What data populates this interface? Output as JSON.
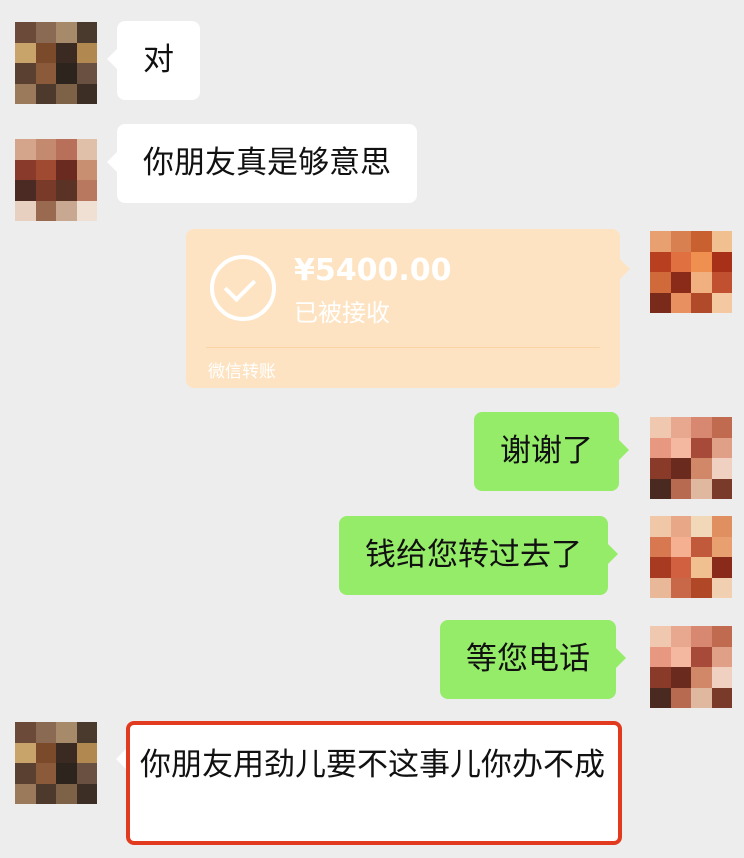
{
  "messages": [
    {
      "text": "对",
      "direction": "incoming"
    },
    {
      "text": "你朋友真是够意思",
      "direction": "incoming"
    },
    {
      "type": "transfer",
      "direction": "outgoing",
      "amount": "¥5400.00",
      "status": "已被接收",
      "footer": "微信转账"
    },
    {
      "text": "谢谢了",
      "direction": "outgoing"
    },
    {
      "text": "钱给您转过去了",
      "direction": "outgoing"
    },
    {
      "text": "等您电话",
      "direction": "outgoing"
    },
    {
      "text": "你朋友用劲儿要不这事儿你办不成",
      "direction": "incoming",
      "highlighted": true
    }
  ],
  "colors": {
    "background": "#ededed",
    "incoming_bubble": "#ffffff",
    "outgoing_bubble": "#95ec69",
    "transfer_card": "#fde3c1",
    "highlight_border": "#e23a1f"
  },
  "avatars": {
    "friend": [
      "#6b4a3a",
      "#8a6a52",
      "#a78a6a",
      "#4a3a2e",
      "#c8a46a",
      "#7a4a2a",
      "#3a2a22",
      "#b08850",
      "#5a4030",
      "#8a5a3a",
      "#2e241e",
      "#6a5040",
      "#9a7a5a",
      "#4e3a2c",
      "#7e6248",
      "#3c2e24"
    ],
    "friend2": [
      "#d4a58a",
      "#c48a70",
      "#b8705a",
      "#e0c0a8",
      "#8a3a2a",
      "#a04a32",
      "#6a2a20",
      "#c89070",
      "#4a2a22",
      "#7a3a2a",
      "#5a3226",
      "#b87860",
      "#e8d0c0",
      "#9a6a50",
      "#c8a890",
      "#f0e0d4"
    ],
    "self": [
      "#e8a070",
      "#d88050",
      "#c86030",
      "#f0c090",
      "#b84020",
      "#e07040",
      "#f09050",
      "#a83018",
      "#d06a3a",
      "#8a2a18",
      "#f0b080",
      "#c05030",
      "#7a2a1a",
      "#e89060",
      "#b04a28",
      "#f4c8a0"
    ],
    "self2": [
      "#f0c8b0",
      "#e8a890",
      "#d88870",
      "#c06a50",
      "#e89880",
      "#f4b8a0",
      "#a84a3a",
      "#e0a088",
      "#8a3a28",
      "#6a2a1e",
      "#d08868",
      "#f0d0c0",
      "#4a2a20",
      "#b86a50",
      "#e0b8a0",
      "#7a3a2a"
    ],
    "self3": [
      "#f0c8a8",
      "#e8a888",
      "#f0d8b8",
      "#e09060",
      "#d87850",
      "#f4b090",
      "#c05a3a",
      "#e8a070",
      "#a83a22",
      "#d06040",
      "#f0c090",
      "#8a2a1a",
      "#e8b898",
      "#c86848",
      "#b04828",
      "#f0d0b0"
    ]
  }
}
